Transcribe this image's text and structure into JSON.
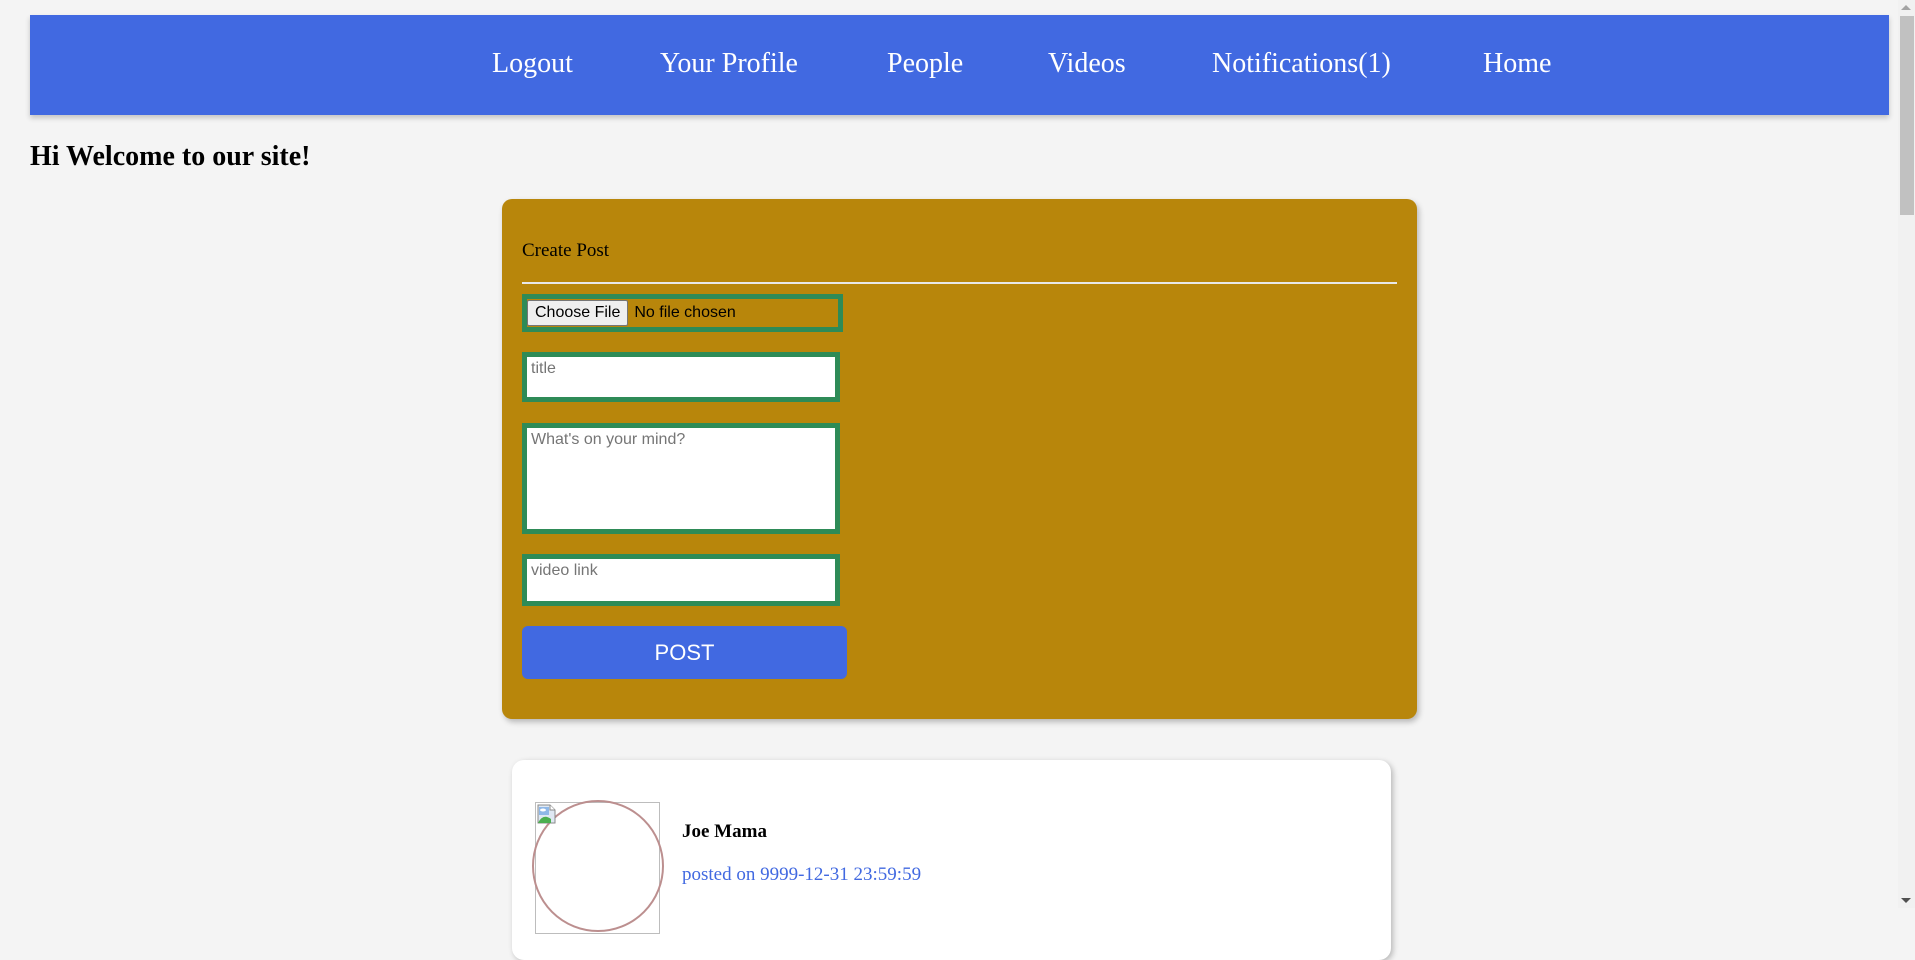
{
  "nav": {
    "items": [
      {
        "label": "Logout"
      },
      {
        "label": "Your Profile"
      },
      {
        "label": "People"
      },
      {
        "label": "Videos"
      },
      {
        "label": "Notifications(1)"
      },
      {
        "label": "Home"
      }
    ]
  },
  "welcome": "Hi Welcome to our site!",
  "create_post": {
    "title": "Create Post",
    "file_button": "Choose File",
    "file_status": "No file chosen",
    "title_placeholder": "title",
    "body_placeholder": "What's on your mind?",
    "video_placeholder": "video link",
    "post_button": "POST"
  },
  "posts": [
    {
      "author": "Joe Mama",
      "posted_on": "posted on 9999-12-31 23:59:59",
      "avatar_icon": "broken-image-icon"
    }
  ],
  "colors": {
    "nav_bg": "#4169e1",
    "card_bg": "#b8860b",
    "field_border": "#2e8b57",
    "date_text": "#4169e1",
    "avatar_border": "#bc8f8f"
  }
}
